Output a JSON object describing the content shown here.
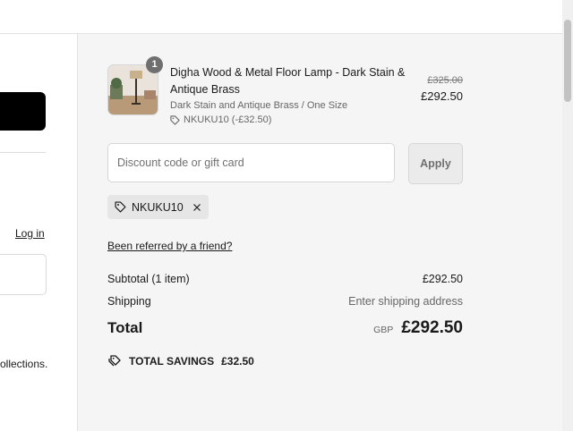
{
  "left": {
    "login_link": "Log in",
    "collections_text": "ollections."
  },
  "product": {
    "quantity": "1",
    "title": "Digha Wood & Metal Floor Lamp - Dark Stain & Antique Brass",
    "variant": "Dark Stain and Antique Brass / One Size",
    "code": "NKUKU10 (-£32.50)",
    "original_price": "£325.00",
    "price": "£292.50"
  },
  "discount": {
    "placeholder": "Discount code or gift card",
    "apply_label": "Apply",
    "applied_code": "NKUKU10"
  },
  "referral_link": "Been referred by a friend?",
  "totals": {
    "subtotal_label": "Subtotal (1 item)",
    "subtotal_value": "£292.50",
    "shipping_label": "Shipping",
    "shipping_value": "Enter shipping address",
    "total_label": "Total",
    "currency": "GBP",
    "total_value": "£292.50"
  },
  "savings": {
    "label": "TOTAL SAVINGS",
    "value": "£32.50"
  },
  "icons": {
    "tag": "tag-icon",
    "close": "close-icon",
    "savings": "savings-tag-icon"
  }
}
